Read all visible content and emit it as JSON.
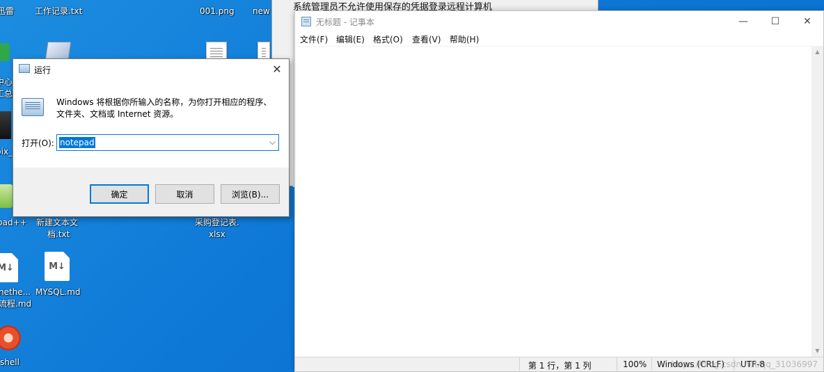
{
  "desktop": {
    "icons": [
      {
        "label": "迅雷",
        "icon": "app-icon"
      },
      {
        "label": "工作记录.txt",
        "icon": "text-file-icon"
      },
      {
        "label": "001.png",
        "icon": "image-file-icon"
      },
      {
        "label": "new",
        "icon": "file-icon"
      },
      {
        "label": "中心",
        "icon": "app-icon"
      },
      {
        "label": "工总",
        "icon": "app-icon"
      },
      {
        "label": "pix_",
        "icon": "app-icon"
      },
      {
        "label": "pad++",
        "icon": "notepad-plus-icon"
      },
      {
        "label": "新建文本文",
        "label2": "档.txt",
        "icon": "text-file-icon"
      },
      {
        "label": "采购登记表.",
        "label2": "xlsx",
        "icon": "excel-file-icon"
      },
      {
        "label": "nethe...",
        "label2": "流程.md",
        "icon": "markdown-file-icon"
      },
      {
        "label": "MYSQL.md",
        "icon": "markdown-file-icon"
      },
      {
        "label": "shell",
        "icon": "shell-app-icon"
      }
    ],
    "md_glyph": "M↓"
  },
  "background_window": {
    "title": "系统管理员不允许使用保存的凭据登录远程计算机"
  },
  "notepad": {
    "title": "无标题 - 记事本",
    "controls": {
      "minimize": "—",
      "maximize": "☐",
      "close": "✕"
    },
    "menu": [
      "文件(F)",
      "编辑(E)",
      "格式(O)",
      "查看(V)",
      "帮助(H)"
    ],
    "content": "",
    "status": {
      "position": "第 1 行，第 1 列",
      "zoom": "100%",
      "line_ending": "Windows (CRLF)",
      "encoding": "UTF-8"
    },
    "watermark": "https://blog.csdn.net/qq_31036997"
  },
  "run_dialog": {
    "title": "运行",
    "close": "✕",
    "description": "Windows 将根据你所输入的名称，为你打开相应的程序、文件夹、文档或 Internet 资源。",
    "open_label": "打开(O):",
    "input_value": "notepad",
    "buttons": {
      "ok": "确定",
      "cancel": "取消",
      "browse": "浏览(B)..."
    }
  }
}
